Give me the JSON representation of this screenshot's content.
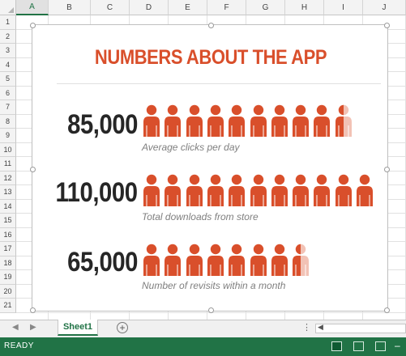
{
  "grid": {
    "columns": [
      "A",
      "B",
      "C",
      "D",
      "E",
      "F",
      "G",
      "H",
      "I",
      "J"
    ],
    "selected_column": "A",
    "rows": [
      "1",
      "2",
      "3",
      "4",
      "5",
      "6",
      "7",
      "8",
      "9",
      "10",
      "11",
      "12",
      "13",
      "14",
      "15",
      "16",
      "17",
      "18",
      "19",
      "20",
      "21"
    ]
  },
  "infographic": {
    "title": "NUMBERS ABOUT THE APP",
    "icon_color": "#d94f2b",
    "stats": [
      {
        "value": "85,000",
        "caption": "Average clicks per day",
        "icons": 9.5
      },
      {
        "value": "110,000",
        "caption": "Total downloads from store",
        "icons": 11
      },
      {
        "value": "65,000",
        "caption": "Number of revisits within a month",
        "icons": 7.5
      }
    ]
  },
  "tabs": {
    "sheets": [
      "Sheet1"
    ],
    "active": "Sheet1",
    "add_icon": "plus-circle-icon",
    "more_icon": "vertical-ellipsis-icon"
  },
  "status": {
    "text": "READY",
    "accent": "#217346",
    "view_icons": [
      "normal-view-icon",
      "page-layout-icon",
      "page-break-preview-icon"
    ]
  }
}
